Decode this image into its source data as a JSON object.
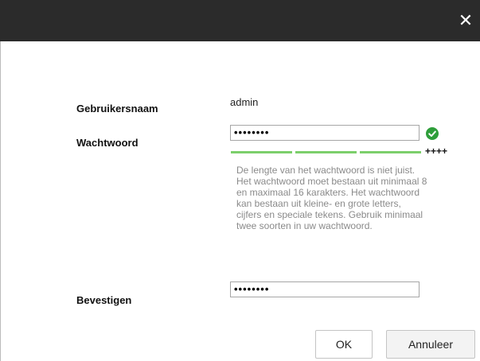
{
  "dialog": {
    "close_icon": "close-icon"
  },
  "form": {
    "username_label": "Gebruikersnaam",
    "username_value": "admin",
    "password_label": "Wachtwoord",
    "password_value": "••••••••",
    "password_valid_icon": "check-circle-icon",
    "strength_text": "++++",
    "strength_level": 1.0,
    "strength_color": "#7ccf6b",
    "hint": "De lengte van het wachtwoord is niet juist. Het wachtwoord moet bestaan uit minimaal 8 en maximaal 16 karakters. Het wachtwoord kan bestaan uit kleine- en grote letters, cijfers en speciale tekens. Gebruik minimaal twee soorten in uw wachtwoord.",
    "confirm_label": "Bevestigen",
    "confirm_value": "••••••••"
  },
  "buttons": {
    "ok": "OK",
    "cancel": "Annuleer"
  },
  "colors": {
    "titlebar": "#2b2b2b",
    "success": "#2e9e3a"
  }
}
